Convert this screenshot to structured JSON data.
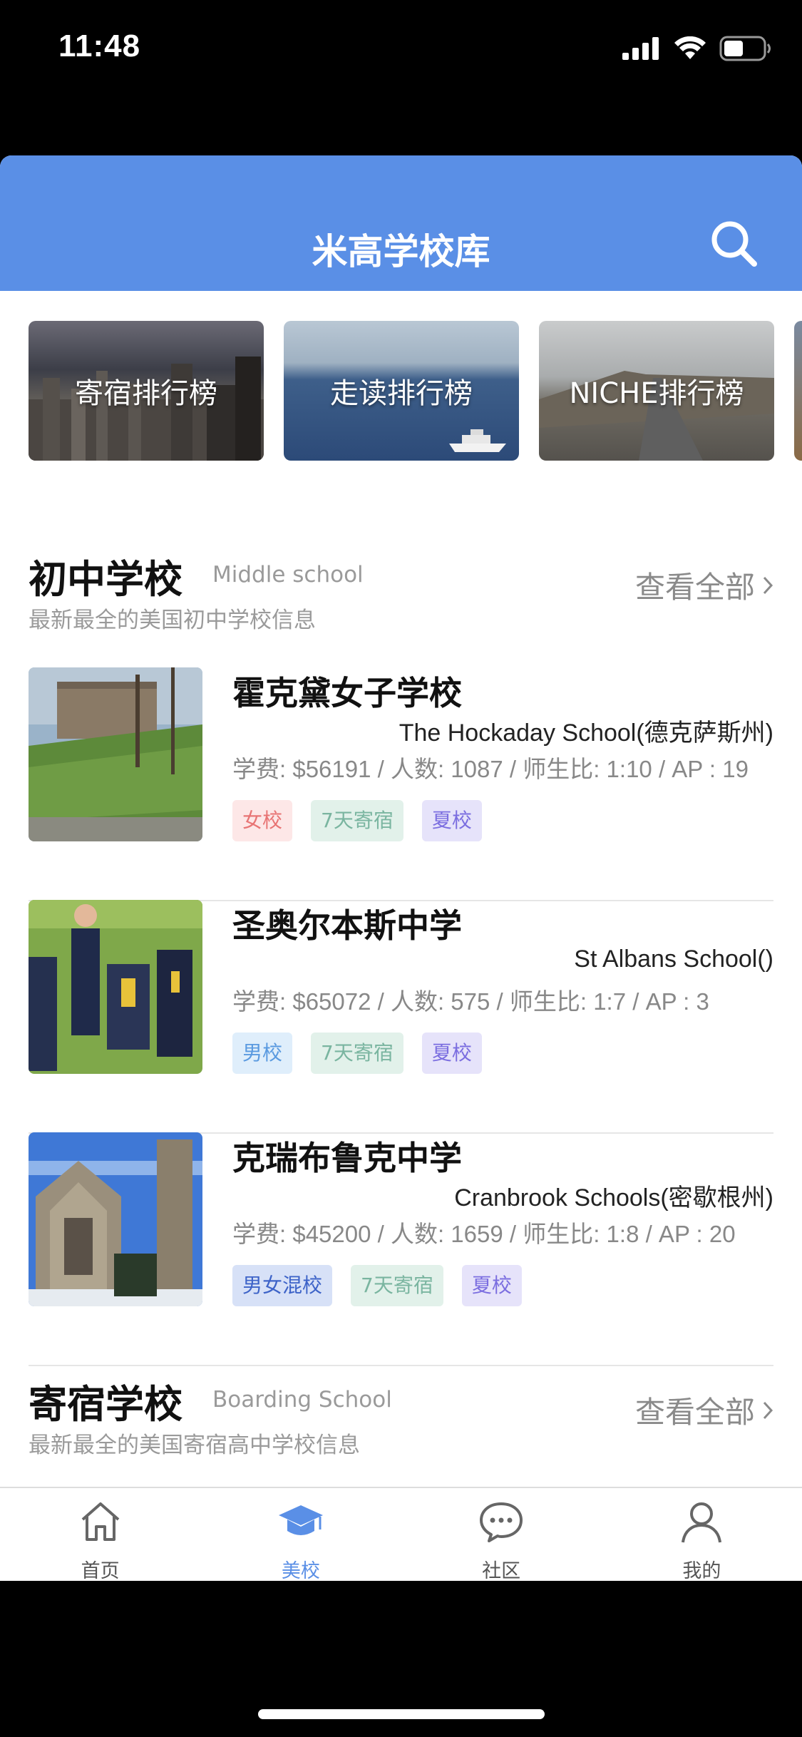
{
  "status": {
    "time": "11:48"
  },
  "header": {
    "title": "米高学校库"
  },
  "banners": [
    {
      "label": "寄宿排行榜"
    },
    {
      "label": "走读排行榜"
    },
    {
      "label": "NICHE排行榜"
    }
  ],
  "middle_section": {
    "title": "初中学校",
    "subtitle": "Middle school",
    "description": "最新最全的美国初中学校信息",
    "see_all": "查看全部"
  },
  "schools": [
    {
      "name_cn": "霍克黛女子学校",
      "name_en": "The Hockaday School(德克萨斯州)",
      "stats": "学费: $56191 / 人数: 1087 / 师生比: 1:10 / AP : 19",
      "tags": [
        "女校",
        "7天寄宿",
        "夏校"
      ]
    },
    {
      "name_cn": "圣奥尔本斯中学",
      "name_en": "St Albans School()",
      "stats": "学费: $65072 / 人数: 575 / 师生比: 1:7 / AP : 3",
      "tags": [
        "男校",
        "7天寄宿",
        "夏校"
      ]
    },
    {
      "name_cn": "克瑞布鲁克中学",
      "name_en": "Cranbrook Schools(密歇根州)",
      "stats": "学费: $45200 / 人数: 1659 / 师生比: 1:8 / AP : 20",
      "tags": [
        "男女混校",
        "7天寄宿",
        "夏校"
      ]
    }
  ],
  "boarding_section": {
    "title": "寄宿学校",
    "subtitle": "Boarding School",
    "description": "最新最全的美国寄宿高中学校信息",
    "see_all": "查看全部"
  },
  "tabbar": [
    {
      "label": "首页",
      "icon": "home-icon"
    },
    {
      "label": "美校",
      "icon": "graduation-cap-icon",
      "active": true
    },
    {
      "label": "社区",
      "icon": "chat-bubble-icon"
    },
    {
      "label": "我的",
      "icon": "user-icon"
    }
  ],
  "colors": {
    "primary": "#5a8fe6",
    "tag_girls": "#e87474",
    "tag_boys": "#5a9ae0",
    "tag_coed": "#3d63c8",
    "tag_boarding": "#7ab5a0",
    "tag_summer": "#7b6ee0"
  }
}
